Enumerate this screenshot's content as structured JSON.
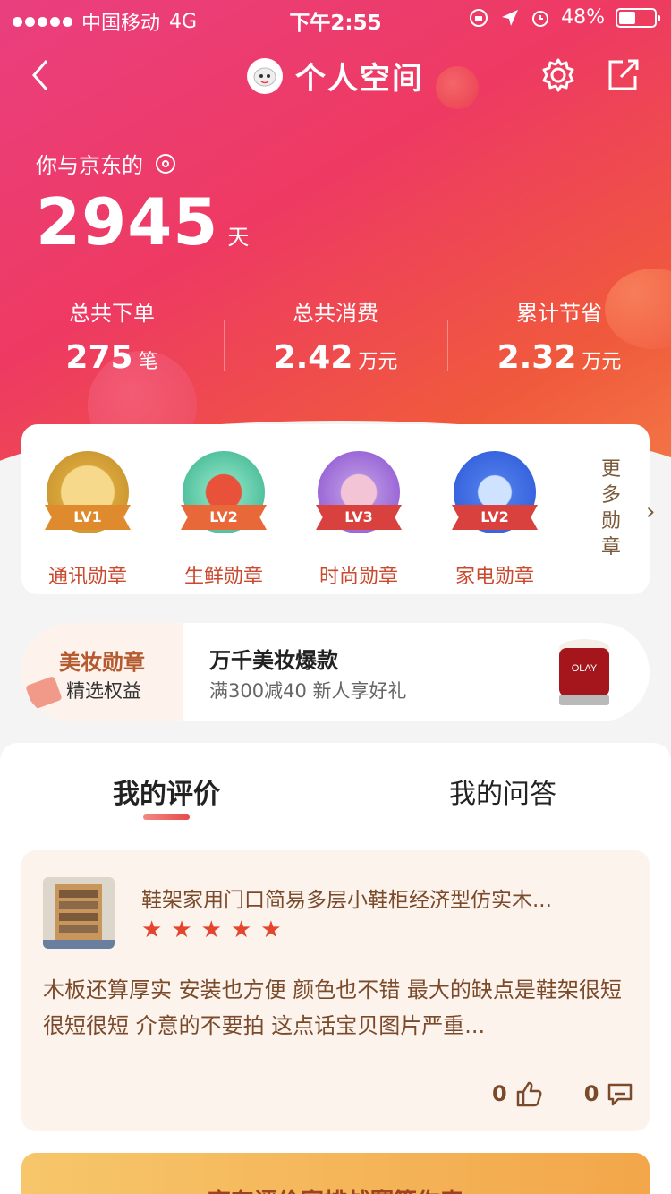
{
  "status": {
    "carrier": "中国移动",
    "network": "4G",
    "time": "下午2:55",
    "battery": "48%",
    "battery_level": 0.48
  },
  "nav": {
    "title": "个人空间"
  },
  "hero": {
    "intro": "你与京东的",
    "days": "2945",
    "days_unit": "天",
    "stats": [
      {
        "label": "总共下单",
        "value": "275",
        "unit": "笔"
      },
      {
        "label": "总共消费",
        "value": "2.42",
        "unit": "万元"
      },
      {
        "label": "累计节省",
        "value": "2.32",
        "unit": "万元"
      }
    ]
  },
  "medals": {
    "items": [
      {
        "name": "通讯勋章",
        "level": "LV1",
        "color": "#d8a53a",
        "ribbon": "#e08a2e"
      },
      {
        "name": "生鲜勋章",
        "level": "LV2",
        "color": "#35b08a",
        "ribbon": "#e8683a"
      },
      {
        "name": "时尚勋章",
        "level": "LV3",
        "color": "#8a4fd0",
        "ribbon": "#d8413d"
      },
      {
        "name": "家电勋章",
        "level": "LV2",
        "color": "#2a56d6",
        "ribbon": "#d8413d"
      }
    ],
    "more": "更多勋章"
  },
  "beauty": {
    "badge_title": "美妆勋章",
    "badge_sub": "精选权益",
    "promo_title": "万千美妆爆款",
    "promo_sub": "满300减40  新人享好礼",
    "product_brand": "OLAY"
  },
  "tabs": [
    {
      "label": "我的评价"
    },
    {
      "label": "我的问答"
    }
  ],
  "review": {
    "title": "鞋架家用门口简易多层小鞋柜经济型仿实木...",
    "stars": 5,
    "text": "木板还算厚实 安装也方便  颜色也不错  最大的缺点是鞋架很短很短很短  介意的不要拍  这点话宝贝图片严重...",
    "likes": "0",
    "comments": "0"
  },
  "banner": {
    "text": "京东评价家排战赛等你来"
  }
}
